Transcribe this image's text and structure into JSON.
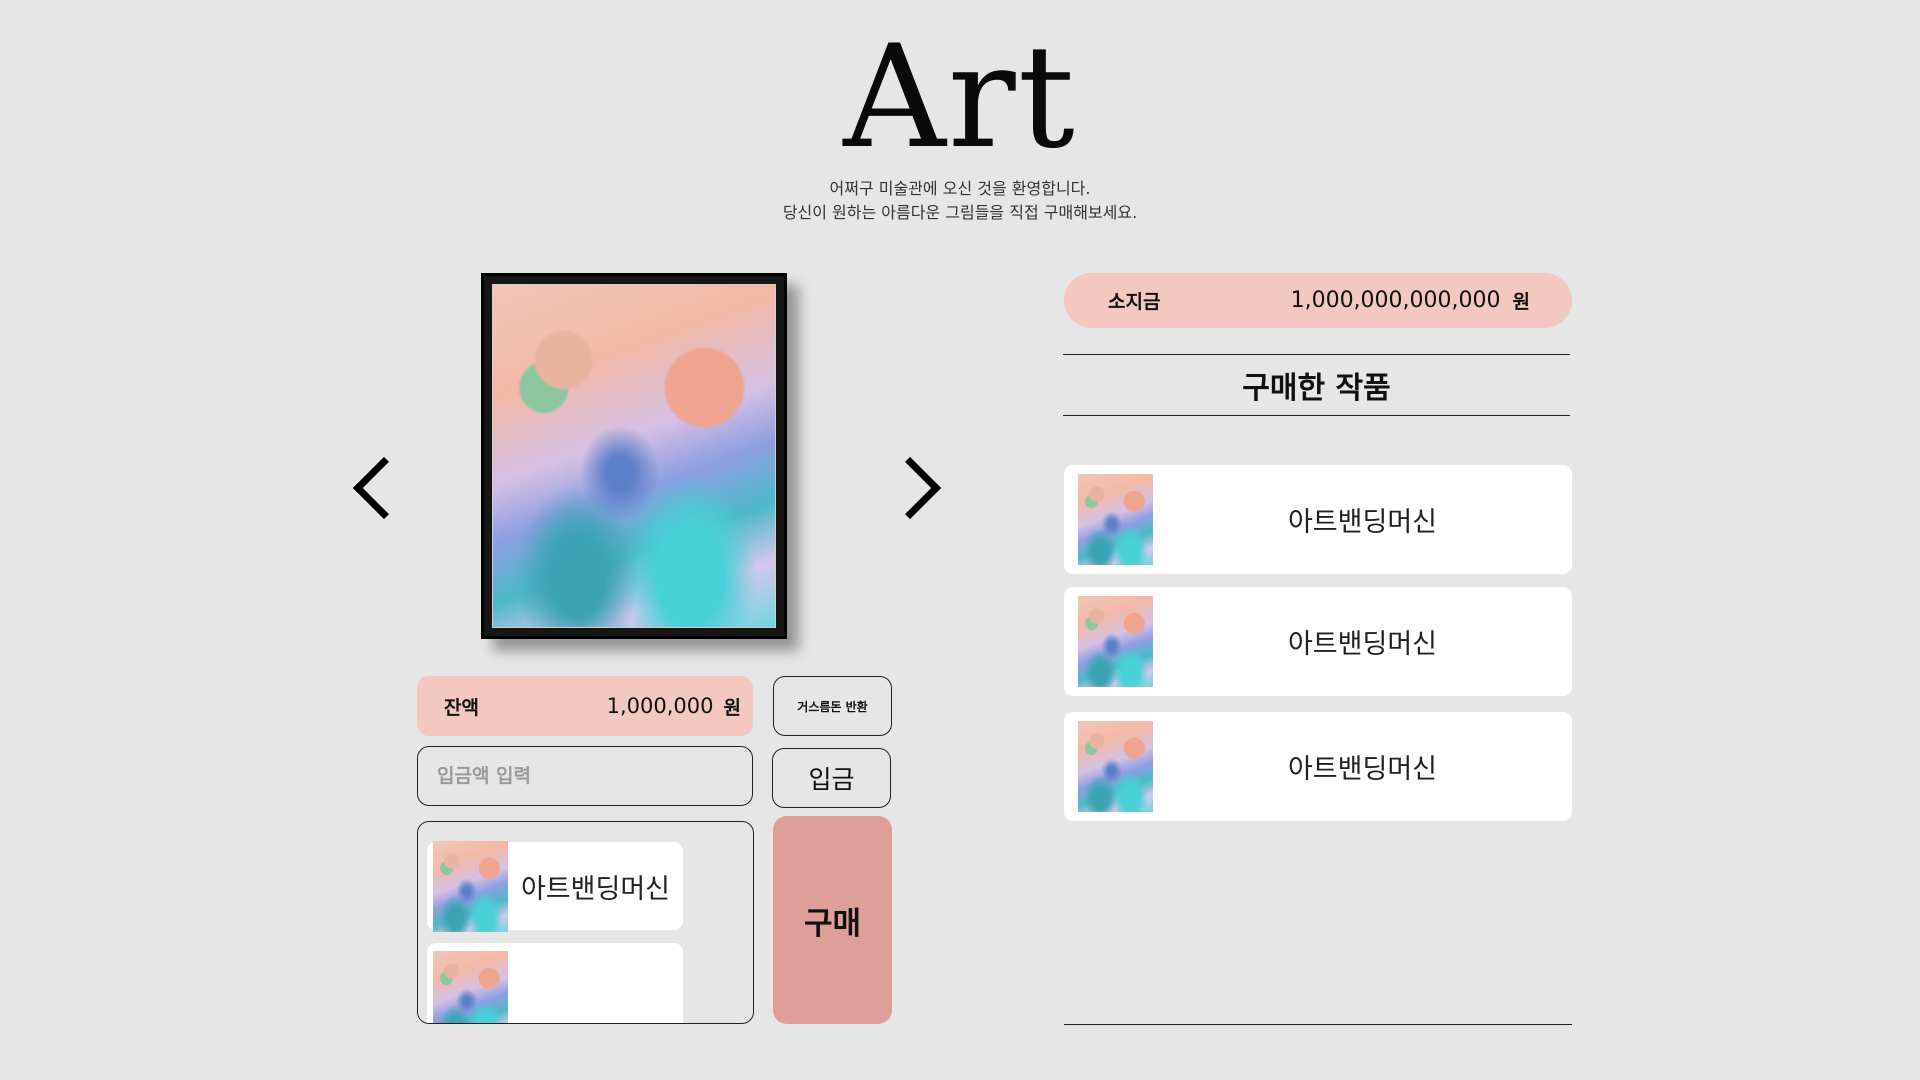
{
  "header": {
    "title": "Art",
    "subtitle_line1": "어쩌구 미술관에 오신 것을 환영합니다.",
    "subtitle_line2": "당신이 원하는 아름다운 그림들을 직접 구매해보세요."
  },
  "gallery": {
    "prev_icon": "chevron-left-icon",
    "next_icon": "chevron-right-icon"
  },
  "machine": {
    "balance_label": "잔액",
    "balance_value": "1,000,000",
    "balance_unit": "원",
    "change_button": "거스름돈 반환",
    "deposit_placeholder": "입금액 입력",
    "deposit_button": "입금",
    "buy_button": "구매",
    "products": [
      {
        "name": "아트밴딩머신"
      },
      {
        "name": ""
      }
    ]
  },
  "wallet": {
    "label": "소지금",
    "value": "1,000,000,000,000",
    "unit": "원"
  },
  "purchased": {
    "title": "구매한 작품",
    "items": [
      {
        "name": "아트밴딩머신"
      },
      {
        "name": "아트밴딩머신"
      },
      {
        "name": "아트밴딩머신"
      }
    ]
  },
  "colors": {
    "background": "#e6e6e6",
    "pink": "#f3c8c1",
    "buy": "#df9f99"
  }
}
